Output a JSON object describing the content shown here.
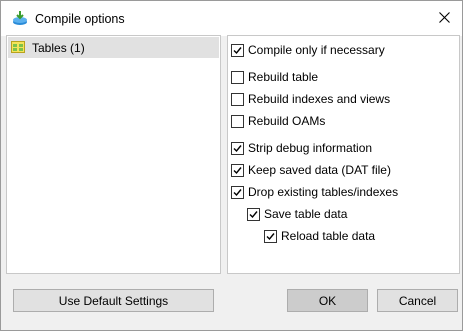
{
  "window": {
    "title": "Compile options",
    "close_icon": "close-icon",
    "app_icon": "compile-app-icon"
  },
  "tree": {
    "items": [
      {
        "label": "Tables (1)",
        "icon": "table-folder-icon",
        "selected": true
      }
    ]
  },
  "options": [
    {
      "label": "Compile only if necessary",
      "checked": true
    },
    {
      "label": "Rebuild table",
      "checked": false
    },
    {
      "label": "Rebuild indexes and views",
      "checked": false
    },
    {
      "label": "Rebuild OAMs",
      "checked": false
    },
    {
      "label": "Strip debug information",
      "checked": true
    },
    {
      "label": "Keep saved data (DAT file)",
      "checked": true
    },
    {
      "label": "Drop existing tables/indexes",
      "checked": true
    },
    {
      "label": "Save table data",
      "checked": true
    },
    {
      "label": "Reload table data",
      "checked": true
    }
  ],
  "buttons": {
    "default_settings": "Use Default Settings",
    "ok": "OK",
    "cancel": "Cancel"
  },
  "colors": {
    "selection": "#e1e1e1",
    "dialog_bg": "#f0f0f0",
    "button_bg": "#e1e1e1"
  }
}
